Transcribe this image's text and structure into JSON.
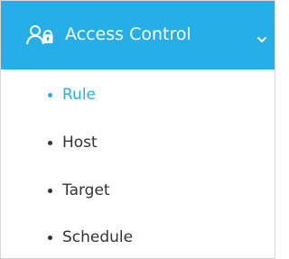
{
  "menu": {
    "header": {
      "icon": "users-icon",
      "title": "Access Control",
      "chevron_icon": "chevron-down-icon",
      "background_color": "#26aee8",
      "text_color": "#ffffff"
    },
    "items": [
      {
        "label": "Rule",
        "active": true
      },
      {
        "label": "Host",
        "active": false
      },
      {
        "label": "Target",
        "active": false
      },
      {
        "label": "Schedule",
        "active": false
      }
    ],
    "active_color": "#26aee8",
    "inactive_color": "#333333"
  }
}
